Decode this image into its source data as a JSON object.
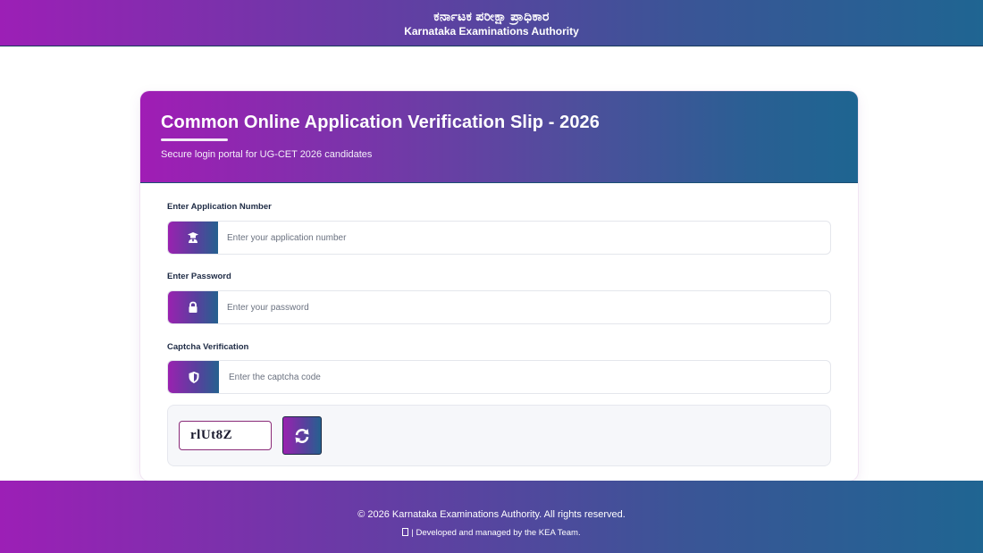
{
  "header": {
    "title_kannada": "ಕರ್ನಾಟಕ ಪರೀಕ್ಷಾ ಪ್ರಾಧಿಕಾರ",
    "title_english": "Karnataka Examinations Authority"
  },
  "card": {
    "title": "Common Online Application Verification Slip - 2026",
    "subtitle": "Secure login portal for UG-CET 2026 candidates"
  },
  "form": {
    "application": {
      "label": "Enter Application Number",
      "placeholder": "Enter your application number",
      "value": "",
      "icon": "user-graduate-icon"
    },
    "password": {
      "label": "Enter Password",
      "placeholder": "Enter your password",
      "value": "",
      "icon": "lock-icon"
    },
    "captcha": {
      "label": "Captcha Verification",
      "placeholder": "Enter the captcha code",
      "value": "",
      "icon": "shield-icon",
      "code": "rlUt8Z",
      "refresh_icon": "refresh-icon"
    }
  },
  "footer": {
    "copyright": "© 2026 Karnataka Examinations Authority. All rights reserved.",
    "developed_by": "| Developed and managed by the KEA Team."
  },
  "colors": {
    "gradient_start": "#9c1fb6",
    "gradient_end": "#1f6592",
    "captcha_border": "#8a2a78"
  }
}
